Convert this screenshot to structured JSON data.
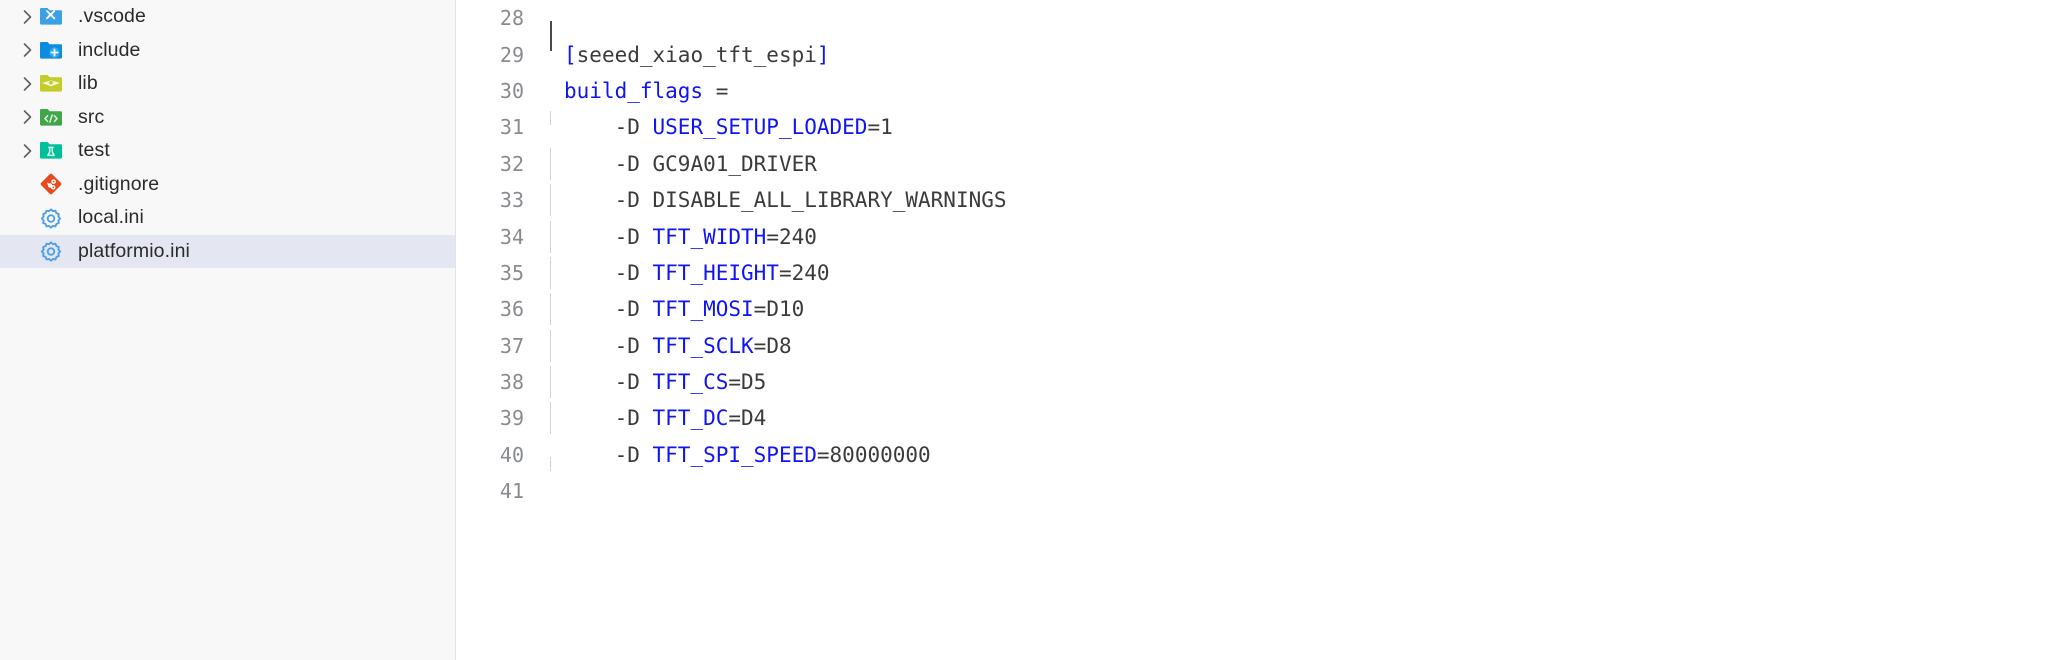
{
  "sidebar": {
    "name": "file-explorer",
    "background": "#f8f8f8",
    "selected_background": "#e4e6f1",
    "items": [
      {
        "label": ".vscode",
        "icon": "folder-vscode-icon",
        "expandable": true,
        "selected": false,
        "icon_color": "#3aa0e8"
      },
      {
        "label": "include",
        "icon": "folder-include-icon",
        "expandable": true,
        "selected": false,
        "icon_color": "#0b8ce0"
      },
      {
        "label": "lib",
        "icon": "folder-lib-icon",
        "expandable": true,
        "selected": false,
        "icon_color": "#c3cc28"
      },
      {
        "label": "src",
        "icon": "folder-src-icon",
        "expandable": true,
        "selected": false,
        "icon_color": "#41a54a"
      },
      {
        "label": "test",
        "icon": "folder-test-icon",
        "expandable": true,
        "selected": false,
        "icon_color": "#00c09a"
      },
      {
        "label": ".gitignore",
        "icon": "git-icon",
        "expandable": false,
        "selected": false,
        "icon_color": "#e8491f"
      },
      {
        "label": "local.ini",
        "icon": "gear-icon",
        "expandable": false,
        "selected": false,
        "icon_color": "#4a9eea"
      },
      {
        "label": "platformio.ini",
        "icon": "gear-icon",
        "expandable": false,
        "selected": true,
        "icon_color": "#4a9eea"
      }
    ]
  },
  "editor": {
    "name": "code-editor",
    "language": "ini",
    "file": "platformio.ini",
    "colors": {
      "keyword": "#0f14f5",
      "text": "#3b3b3b",
      "line_number": "#888b8f",
      "indent_guide": "#d3d3d3",
      "background": "#ffffff"
    },
    "cursor_line": 28,
    "lines": [
      {
        "n": "28",
        "indent": false,
        "guide": "none",
        "caret": true,
        "tokens": []
      },
      {
        "n": "29",
        "indent": false,
        "guide": "none",
        "caret": false,
        "tokens": [
          {
            "t": "[",
            "c": "blue"
          },
          {
            "t": "seeed_xiao_tft_espi",
            "c": "dark"
          },
          {
            "t": "]",
            "c": "blue"
          }
        ]
      },
      {
        "n": "30",
        "indent": false,
        "guide": "none",
        "caret": false,
        "tokens": [
          {
            "t": "build_flags",
            "c": "blue"
          },
          {
            "t": " = ",
            "c": "dark"
          }
        ]
      },
      {
        "n": "31",
        "indent": true,
        "guide": "top",
        "caret": false,
        "tokens": [
          {
            "t": "    -D ",
            "c": "dark"
          },
          {
            "t": "USER_SETUP_LOADED",
            "c": "blue"
          },
          {
            "t": "=1",
            "c": "dark"
          }
        ]
      },
      {
        "n": "32",
        "indent": true,
        "guide": "full",
        "caret": false,
        "tokens": [
          {
            "t": "    -D ",
            "c": "dark"
          },
          {
            "t": "GC9A01_DRIVER",
            "c": "dark"
          }
        ]
      },
      {
        "n": "33",
        "indent": true,
        "guide": "full",
        "caret": false,
        "tokens": [
          {
            "t": "    -D ",
            "c": "dark"
          },
          {
            "t": "DISABLE_ALL_LIBRARY_WARNINGS",
            "c": "dark"
          }
        ]
      },
      {
        "n": "34",
        "indent": true,
        "guide": "full",
        "caret": false,
        "tokens": [
          {
            "t": "    -D ",
            "c": "dark"
          },
          {
            "t": "TFT_WIDTH",
            "c": "blue"
          },
          {
            "t": "=240",
            "c": "dark"
          }
        ]
      },
      {
        "n": "35",
        "indent": true,
        "guide": "full",
        "caret": false,
        "tokens": [
          {
            "t": "    -D ",
            "c": "dark"
          },
          {
            "t": "TFT_HEIGHT",
            "c": "blue"
          },
          {
            "t": "=240",
            "c": "dark"
          }
        ]
      },
      {
        "n": "36",
        "indent": true,
        "guide": "full",
        "caret": false,
        "tokens": [
          {
            "t": "    -D ",
            "c": "dark"
          },
          {
            "t": "TFT_MOSI",
            "c": "blue"
          },
          {
            "t": "=D10",
            "c": "dark"
          }
        ]
      },
      {
        "n": "37",
        "indent": true,
        "guide": "full",
        "caret": false,
        "tokens": [
          {
            "t": "    -D ",
            "c": "dark"
          },
          {
            "t": "TFT_SCLK",
            "c": "blue"
          },
          {
            "t": "=D8",
            "c": "dark"
          }
        ]
      },
      {
        "n": "38",
        "indent": true,
        "guide": "full",
        "caret": false,
        "tokens": [
          {
            "t": "    -D ",
            "c": "dark"
          },
          {
            "t": "TFT_CS",
            "c": "blue"
          },
          {
            "t": "=D5",
            "c": "dark"
          }
        ]
      },
      {
        "n": "39",
        "indent": true,
        "guide": "full",
        "caret": false,
        "tokens": [
          {
            "t": "    -D ",
            "c": "dark"
          },
          {
            "t": "TFT_DC",
            "c": "blue"
          },
          {
            "t": "=D4",
            "c": "dark"
          }
        ]
      },
      {
        "n": "40",
        "indent": true,
        "guide": "short",
        "caret": false,
        "tokens": [
          {
            "t": "    -D ",
            "c": "dark"
          },
          {
            "t": "TFT_SPI_SPEED",
            "c": "blue"
          },
          {
            "t": "=80000000",
            "c": "dark"
          }
        ]
      },
      {
        "n": "41",
        "indent": false,
        "guide": "none",
        "caret": false,
        "tokens": []
      }
    ]
  }
}
